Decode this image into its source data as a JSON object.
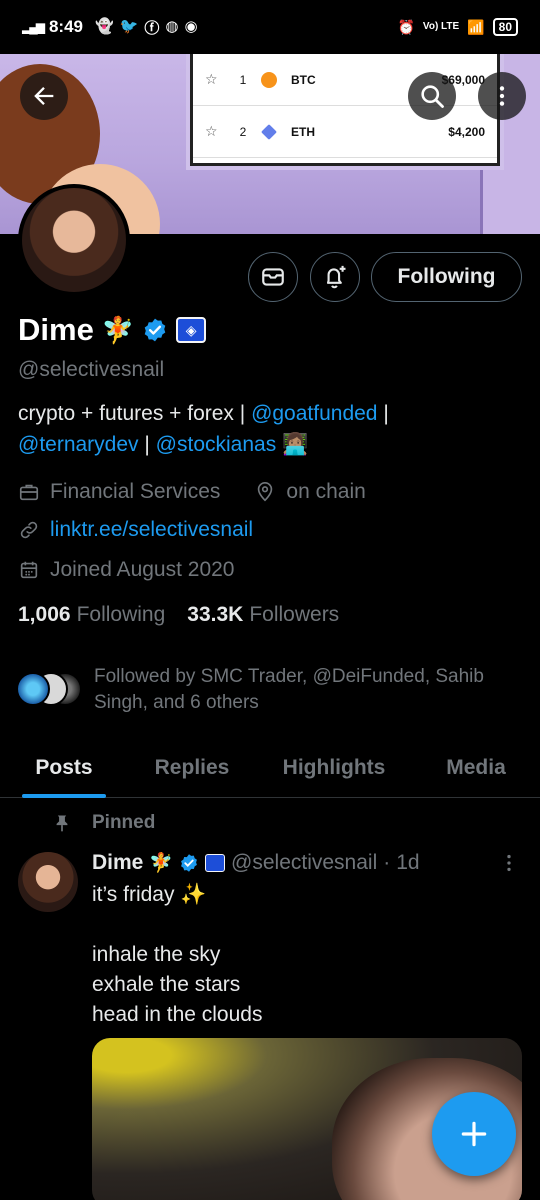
{
  "status_bar": {
    "time": "8:49",
    "network": "Vo) LTE",
    "battery": "80"
  },
  "banner": {
    "rows": [
      {
        "rank": "1",
        "symbol": "BTC",
        "price": "$69,000",
        "coin_color": "#f7931a"
      },
      {
        "rank": "2",
        "symbol": "ETH",
        "price": "$4,200",
        "coin_color": "#627eea"
      }
    ]
  },
  "profile": {
    "display_name": "Dime",
    "name_emoji": "🧚",
    "handle": "@selectivesnail",
    "follow_button": "Following",
    "bio": {
      "text1": "crypto + futures + forex | ",
      "mention1": "@goatfunded",
      "sep1": " | ",
      "mention2": "@ternarydev",
      "sep2": " | ",
      "mention3": "@stockianas",
      "emoji": " 👩🏽‍💻"
    },
    "category": "Financial Services",
    "location": "on chain",
    "website": "linktr.ee/selectivesnail",
    "joined": "Joined August 2020",
    "following_count": "1,006",
    "following_label": "Following",
    "followers_count": "33.3K",
    "followers_label": "Followers",
    "followed_by": "Followed by SMC Trader, @DeiFunded, Sahib Singh, and 6 others"
  },
  "tabs": [
    "Posts",
    "Replies",
    "Highlights",
    "Media"
  ],
  "post": {
    "pinned_label": "Pinned",
    "author_name": "Dime",
    "name_emoji": "🧚",
    "author_handle": "@selectivesnail",
    "separator": "·",
    "time": "1d",
    "text": "it’s friday ✨\n\ninhale the sky\nexhale the stars\nhead in the clouds"
  },
  "colors": {
    "accent": "#1d9bf0",
    "background": "#000000",
    "muted": "#71767b"
  },
  "icons": [
    "back-arrow-icon",
    "search-icon",
    "more-vertical-icon",
    "mail-icon",
    "bell-plus-icon",
    "verified-icon",
    "briefcase-icon",
    "location-pin-icon",
    "link-icon",
    "calendar-icon",
    "pin-icon",
    "plus-icon"
  ]
}
